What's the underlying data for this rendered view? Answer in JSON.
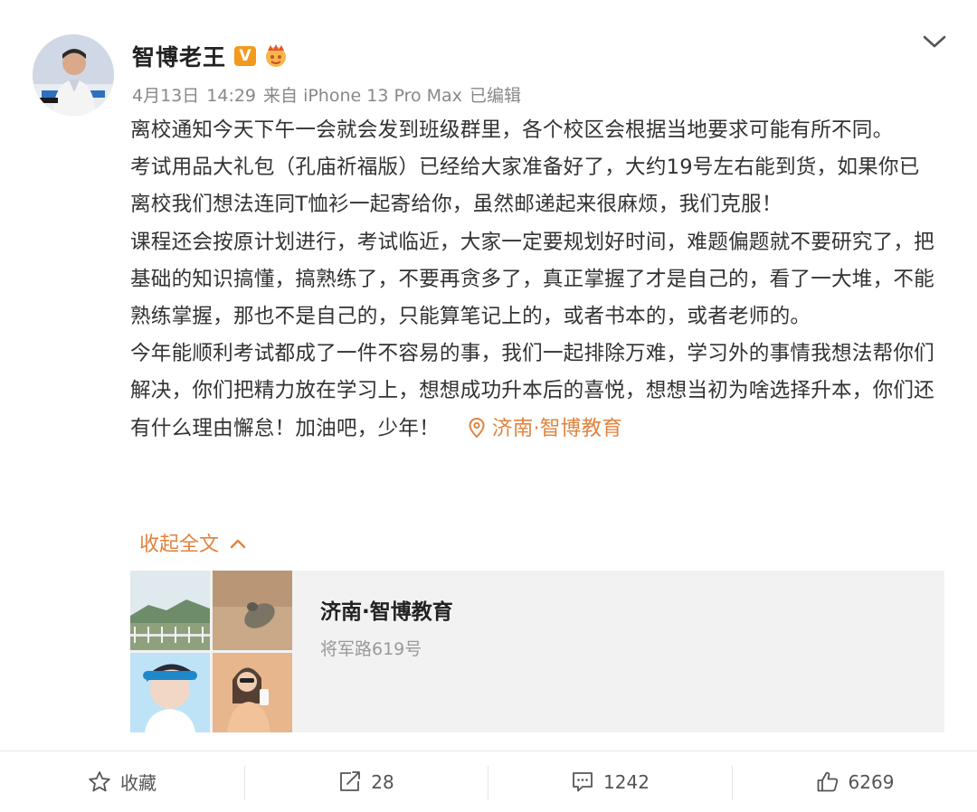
{
  "user": {
    "name": "智博老王",
    "verified_badge": "V"
  },
  "meta": {
    "date": "4月13日",
    "time": "14:29",
    "source": "来自 iPhone 13 Pro Max",
    "edited": "已编辑"
  },
  "post": {
    "paragraphs": [
      "离校通知今天下午一会就会发到班级群里，各个校区会根据当地要求可能有所不同。",
      "考试用品大礼包（孔庙祈福版）已经给大家准备好了，大约19号左右能到货，如果你已离校我们想法连同T恤衫一起寄给你，虽然邮递起来很麻烦，我们克服！",
      "课程还会按原计划进行，考试临近，大家一定要规划好时间，难题偏题就不要研究了，把基础的知识搞懂，搞熟练了，不要再贪多了，真正掌握了才是自己的，看了一大堆，不能熟练掌握，那也不是自己的，只能算笔记上的，或者书本的，或者老师的。",
      "今年能顺利考试都成了一件不容易的事，我们一起排除万难，学习外的事情我想法帮你们解决，你们把精力放在学习上，想想成功升本后的喜悦，想想当初为啥选择升本，你们还有什么理由懈怠！加油吧，少年！"
    ],
    "location_tag": "济南·智博教育",
    "collapse_label": "收起全文"
  },
  "location_card": {
    "title": "济南·智博教育",
    "address": "将军路619号"
  },
  "actions": {
    "favorite_label": "收藏",
    "repost_count": "28",
    "comment_count": "1242",
    "like_count": "6269"
  },
  "colors": {
    "accent": "#e2833f",
    "badge": "#f39a1e",
    "text": "#333333",
    "meta": "#888888"
  },
  "icons": [
    "crown-icon",
    "chevron-down-icon",
    "location-pin-icon",
    "chevron-up-icon",
    "star-icon",
    "repost-icon",
    "comment-icon",
    "thumbs-up-icon"
  ]
}
